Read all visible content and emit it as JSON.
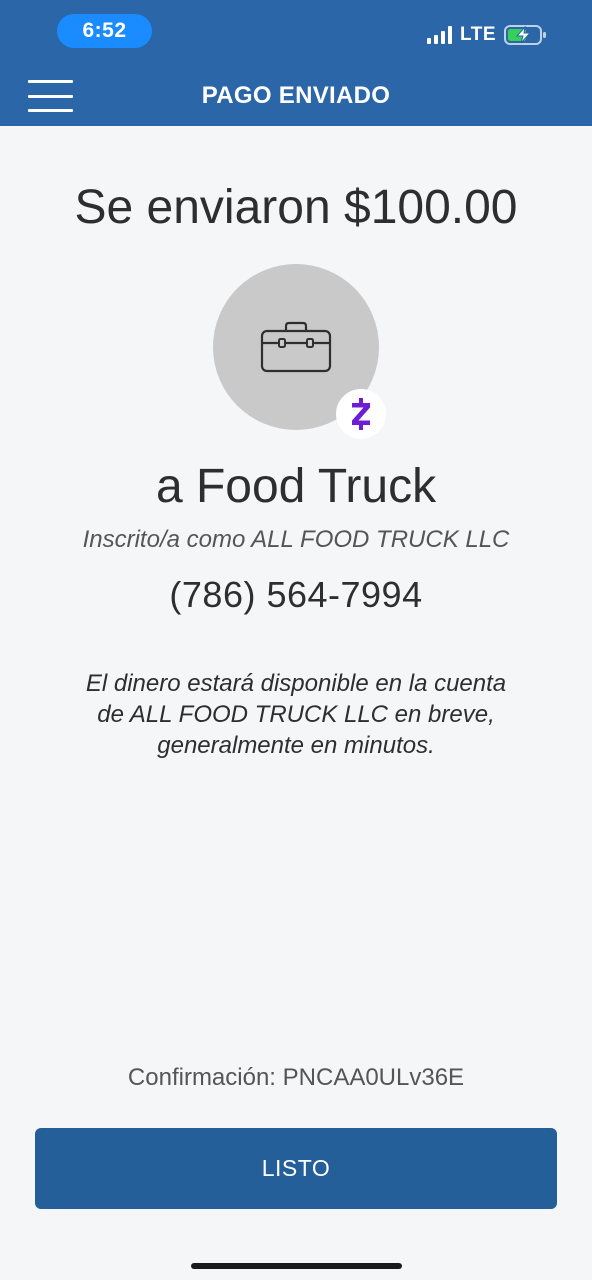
{
  "status_bar": {
    "time": "6:52",
    "network": "LTE",
    "icons": [
      "signal-icon",
      "battery-charging-icon"
    ]
  },
  "nav": {
    "title": "PAGO ENVIADO",
    "menu_icon": "menu-icon"
  },
  "payment": {
    "amount_text": "Se enviaron $100.00",
    "recipient": "a Food Truck",
    "enrolled_as": "Inscrito/a como ALL FOOD TRUCK LLC",
    "phone": "(786) 564-7994",
    "avatar_icon": "briefcase-icon",
    "badge_icon": "zelle-icon",
    "info_message": "El dinero estará disponible en la cuenta de ALL FOOD TRUCK LLC en breve, generalmente en minutos.",
    "confirmation": "Confirmación: PNCAA0ULv36E"
  },
  "actions": {
    "done_label": "LISTO"
  },
  "colors": {
    "header": "#2a66a8",
    "button": "#245f9a",
    "zelle": "#6d1ed4",
    "background": "#f5f6f8"
  }
}
